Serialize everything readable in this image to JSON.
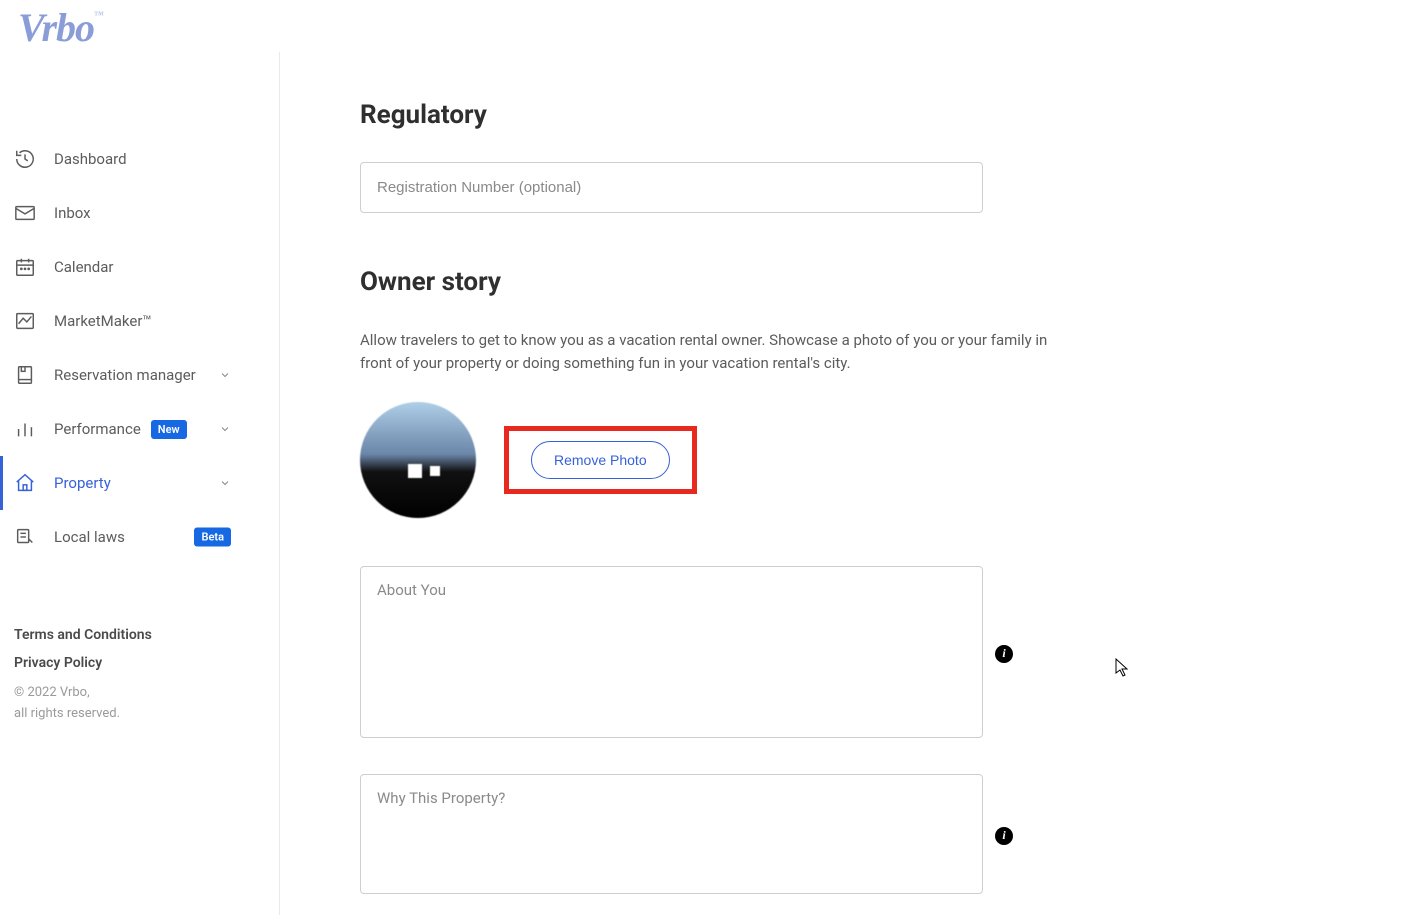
{
  "brand": {
    "name": "Vrbo",
    "tm": "™"
  },
  "sidebar": {
    "items": [
      {
        "label": "Dashboard"
      },
      {
        "label": "Inbox"
      },
      {
        "label": "Calendar"
      },
      {
        "label": "MarketMaker™"
      },
      {
        "label": "Reservation manager"
      },
      {
        "label": "Performance",
        "badge": "New"
      },
      {
        "label": "Property"
      },
      {
        "label": "Local laws",
        "badge": "Beta"
      }
    ],
    "footer": {
      "terms": "Terms and Conditions",
      "privacy": "Privacy Policy",
      "copyright_line1": "© 2022 Vrbo,",
      "copyright_line2": "all rights reserved."
    }
  },
  "main": {
    "regulatory": {
      "title": "Regulatory",
      "reg_placeholder": "Registration Number (optional)"
    },
    "owner_story": {
      "title": "Owner story",
      "description": "Allow travelers to get to know you as a vacation rental owner. Showcase a photo of you or your family in front of your property or doing something fun in your vacation rental's city.",
      "remove_photo_label": "Remove Photo",
      "about_placeholder": "About You",
      "why_placeholder": "Why This Property?"
    }
  }
}
